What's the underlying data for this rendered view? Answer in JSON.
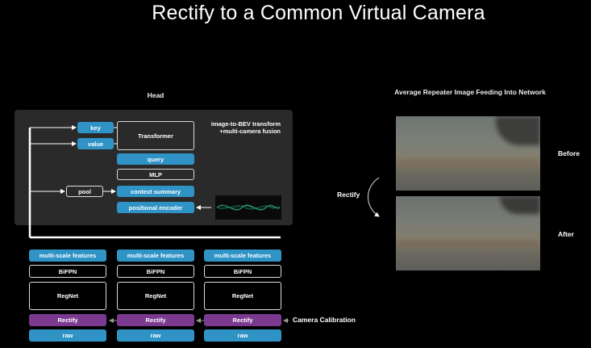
{
  "title": "Rectify to a Common Virtual Camera",
  "head": {
    "heading": "Head",
    "note_line1": "image-to-BEV transform",
    "note_line2": "+multi-camera fusion",
    "key": "key",
    "value": "value",
    "transformer": "Transformer",
    "query": "query",
    "mlp": "MLP",
    "pool": "pool",
    "context_summary": "context summary",
    "positional_encoder": "positional encoder"
  },
  "backbones": [
    {
      "features": "multi-scale features",
      "bifpn": "BiFPN",
      "regnet": "RegNet",
      "rectify": "Rectify",
      "raw": "raw"
    },
    {
      "features": "multi-scale features",
      "bifpn": "BiFPN",
      "regnet": "RegNet",
      "rectify": "Rectify",
      "raw": "raw"
    },
    {
      "features": "multi-scale features",
      "bifpn": "BiFPN",
      "regnet": "RegNet",
      "rectify": "Rectify",
      "raw": "raw"
    }
  ],
  "camera_calibration": "Camera Calibration",
  "right": {
    "heading": "Average Repeater Image Feeding Into Network",
    "before": "Before",
    "after": "After",
    "rectify": "Rectify"
  },
  "colors": {
    "blue": "#2f93c6",
    "purple": "#7b3a8f",
    "panel": "#2a2a2a"
  }
}
